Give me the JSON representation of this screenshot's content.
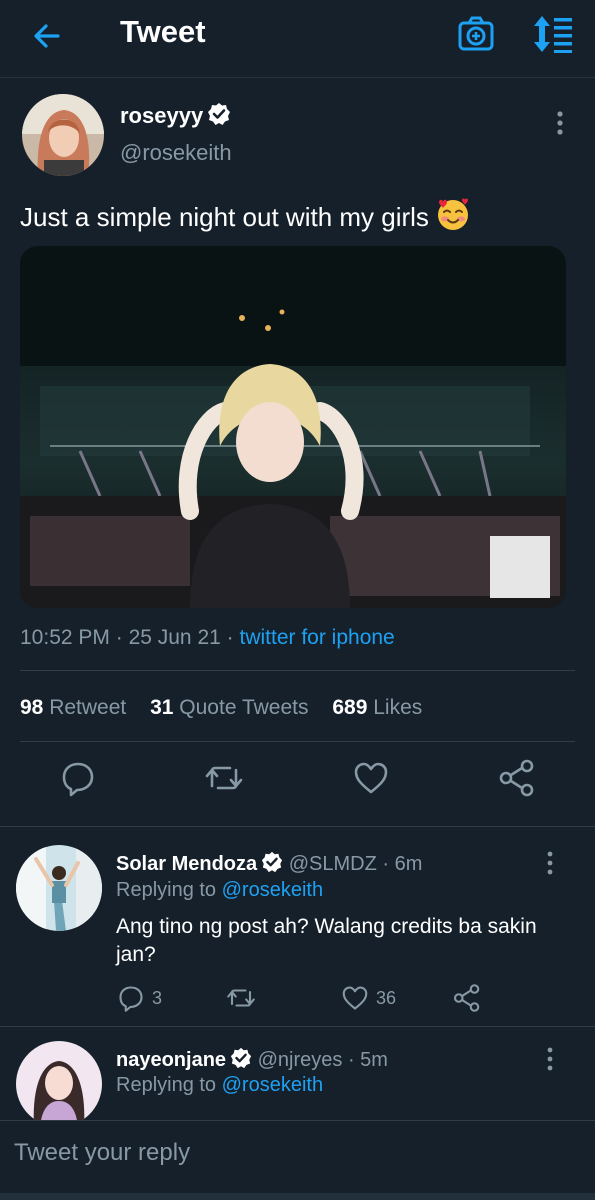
{
  "header": {
    "title": "Tweet",
    "icons": {
      "back": "back-arrow-icon",
      "camera": "camera-plus-icon",
      "sort": "sort-icon"
    },
    "accent": "#1da1f2"
  },
  "tweet": {
    "display_name": "roseyyy",
    "handle": "@rosekeith",
    "text": "Just a simple night out with my girls",
    "emoji": "smiling-face-with-hearts",
    "time": "10:52 PM",
    "date": "25 Jun 21",
    "source": "twitter for iphone",
    "stats": {
      "retweets_count": "98",
      "retweets_label": "Retweet",
      "quotes_count": "31",
      "quotes_label": "Quote Tweets",
      "likes_count": "689",
      "likes_label": "Likes"
    }
  },
  "replies": [
    {
      "display_name": "Solar Mendoza",
      "handle": "@SLMDZ",
      "time": "6m",
      "replying_label": "Replying to",
      "replying_to": "@rosekeith",
      "text": "Ang tino ng post ah? Walang credits ba sakin jan?",
      "reply_count": "3",
      "retweet_count": "",
      "like_count": "36"
    },
    {
      "display_name": "nayeonjane",
      "handle": "@njreyes",
      "time": "5m",
      "replying_label": "Replying to",
      "replying_to": "@rosekeith"
    }
  ],
  "compose": {
    "placeholder": "Tweet your reply"
  }
}
